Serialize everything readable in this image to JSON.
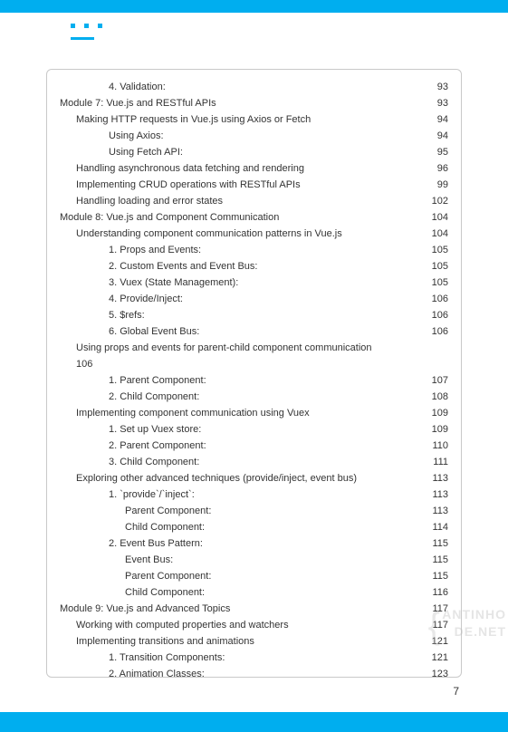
{
  "page_number": "7",
  "watermark": {
    "line1": "ANTINHO",
    "line2": "DE.NET"
  },
  "toc": [
    {
      "indent": 3,
      "label": "4. Validation:",
      "page": "93"
    },
    {
      "indent": 0,
      "label": "Module 7: Vue.js and RESTful APIs",
      "page": "93"
    },
    {
      "indent": 1,
      "label": "Making HTTP requests in Vue.js using Axios or Fetch",
      "page": "94"
    },
    {
      "indent": 3,
      "label": "Using Axios:",
      "page": "94"
    },
    {
      "indent": 3,
      "label": "Using Fetch API:",
      "page": "95"
    },
    {
      "indent": 1,
      "label": "Handling asynchronous data fetching and rendering",
      "page": "96"
    },
    {
      "indent": 1,
      "label": "Implementing CRUD operations with RESTful APIs",
      "page": "99"
    },
    {
      "indent": 1,
      "label": "Handling loading and error states",
      "page": "102"
    },
    {
      "indent": 0,
      "label": "Module 8: Vue.js and Component Communication",
      "page": "104"
    },
    {
      "indent": 1,
      "label": "Understanding component communication patterns in Vue.js",
      "page": "104"
    },
    {
      "indent": 3,
      "label": "1. Props and Events:",
      "page": "105"
    },
    {
      "indent": 3,
      "label": "2. Custom Events and Event Bus:",
      "page": "105"
    },
    {
      "indent": 3,
      "label": "3. Vuex (State Management):",
      "page": "105"
    },
    {
      "indent": 3,
      "label": "4. Provide/Inject:",
      "page": "106"
    },
    {
      "indent": 3,
      "label": "5. $refs:",
      "page": "106"
    },
    {
      "indent": 3,
      "label": "6. Global Event Bus:",
      "page": "106"
    },
    {
      "indent": 1,
      "label": "Using props and events for parent-child component communication",
      "page": ""
    },
    {
      "indent": 1,
      "label": "106",
      "page": ""
    },
    {
      "indent": 3,
      "label": "1. Parent Component:",
      "page": "107"
    },
    {
      "indent": 3,
      "label": "2. Child Component:",
      "page": "108"
    },
    {
      "indent": 1,
      "label": "Implementing component communication using Vuex",
      "page": "109"
    },
    {
      "indent": 3,
      "label": "1. Set up Vuex store:",
      "page": "109"
    },
    {
      "indent": 3,
      "label": "2. Parent Component:",
      "page": "110"
    },
    {
      "indent": 3,
      "label": "3. Child Component:",
      "page": "111"
    },
    {
      "indent": 1,
      "label": "Exploring other advanced techniques (provide/inject, event bus)",
      "page": "113"
    },
    {
      "indent": 3,
      "label": "1. `provide`/`inject`:",
      "page": "113"
    },
    {
      "indent": 4,
      "label": "Parent Component:",
      "page": "113"
    },
    {
      "indent": 4,
      "label": "Child Component:",
      "page": "114"
    },
    {
      "indent": 3,
      "label": "2. Event Bus Pattern:",
      "page": "115"
    },
    {
      "indent": 4,
      "label": "Event Bus:",
      "page": "115"
    },
    {
      "indent": 4,
      "label": "Parent Component:",
      "page": "115"
    },
    {
      "indent": 4,
      "label": "Child Component:",
      "page": "116"
    },
    {
      "indent": 0,
      "label": "Module 9: Vue.js and Advanced Topics",
      "page": "117"
    },
    {
      "indent": 1,
      "label": "Working with computed properties and watchers",
      "page": "117"
    },
    {
      "indent": 1,
      "label": "Implementing transitions and animations",
      "page": "121"
    },
    {
      "indent": 3,
      "label": "1. Transition Components:",
      "page": "121"
    },
    {
      "indent": 3,
      "label": "2. Animation Classes:",
      "page": "123"
    }
  ]
}
